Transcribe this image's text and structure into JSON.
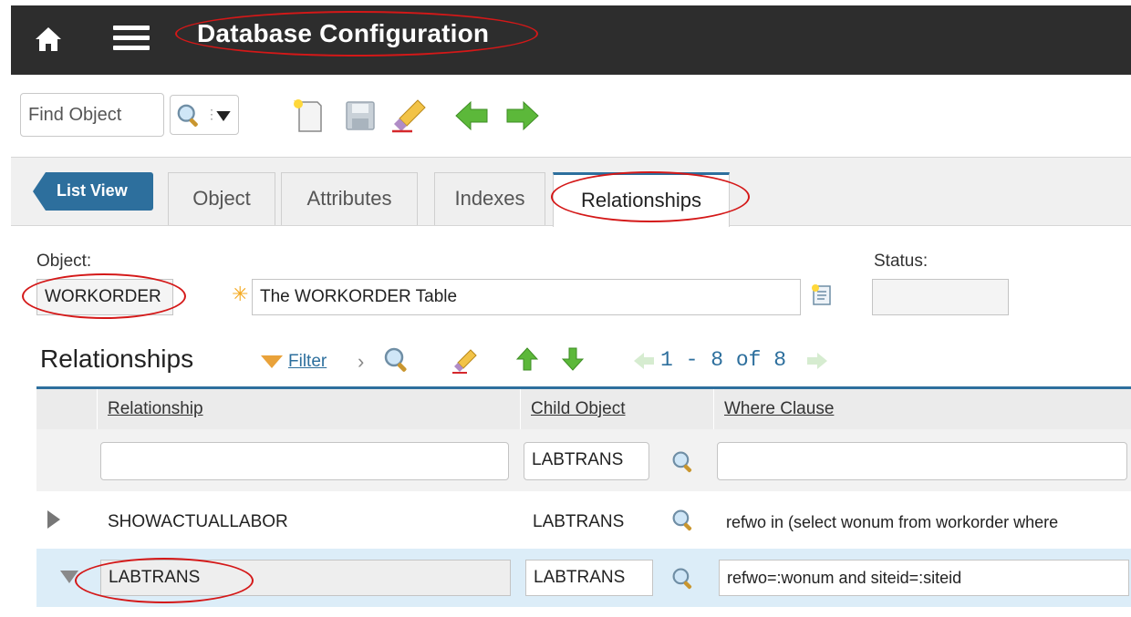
{
  "header": {
    "title": "Database Configuration"
  },
  "toolbar": {
    "find_placeholder": "Find Object"
  },
  "tabs": {
    "list_view": "List View",
    "items": [
      "Object",
      "Attributes",
      "Indexes",
      "Relationships"
    ],
    "active": "Relationships"
  },
  "details": {
    "object_label": "Object:",
    "object_value": "WORKORDER",
    "description_value": "The WORKORDER Table",
    "status_label": "Status:",
    "status_value": ""
  },
  "section": {
    "title": "Relationships",
    "filter_label": "Filter",
    "pager": "1 - 8 of 8"
  },
  "table": {
    "columns": [
      "Relationship",
      "Child Object",
      "Where Clause"
    ],
    "filter_row": {
      "relationship": "",
      "child_object": "LABTRANS",
      "where_clause": ""
    },
    "rows": [
      {
        "relationship": "SHOWACTUALLABOR",
        "child_object": "LABTRANS",
        "where_clause": "refwo in (select wonum from workorder where",
        "expanded": false
      },
      {
        "relationship": "LABTRANS",
        "child_object": "LABTRANS",
        "where_clause": "refwo=:wonum and siteid=:siteid",
        "expanded": true
      }
    ]
  },
  "colors": {
    "header_bg": "#2d2d2d",
    "accent": "#2d6f9d",
    "selected_row": "#dcedf8",
    "annotation": "#d41818"
  }
}
